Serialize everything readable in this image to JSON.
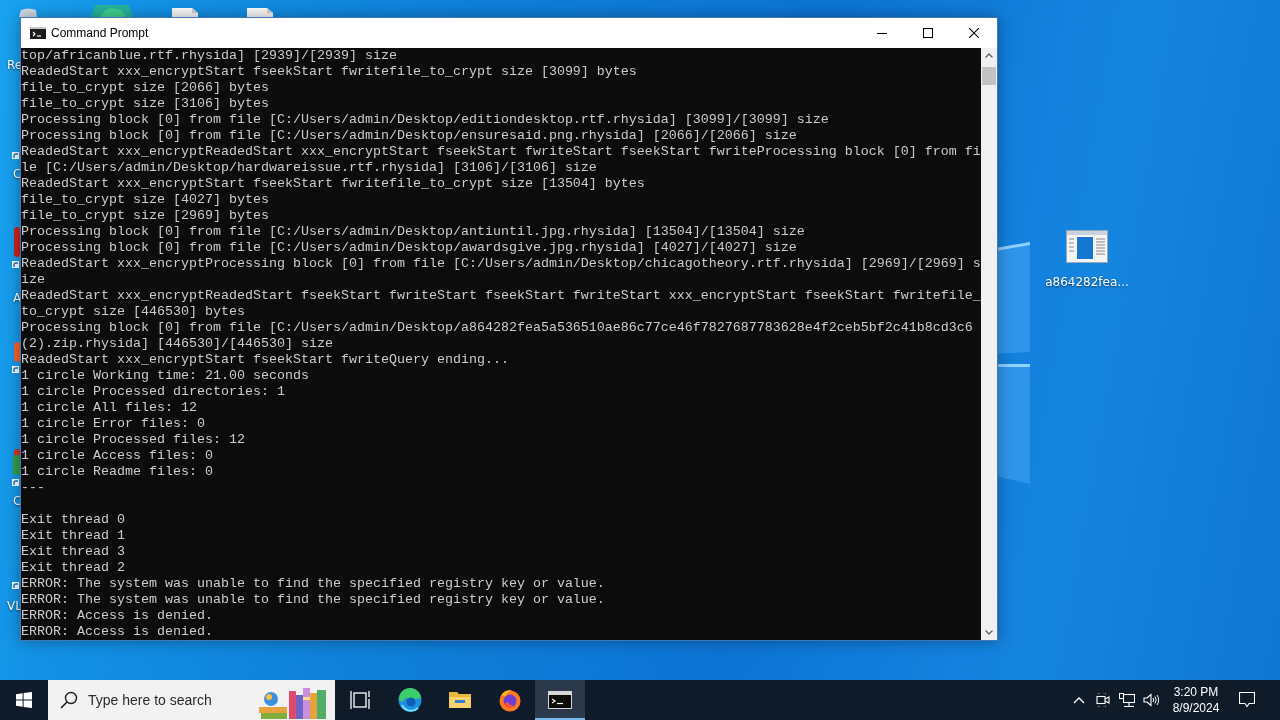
{
  "desktop": {
    "icons": [
      {
        "kind": "recycle-bin",
        "label": "Re"
      },
      {
        "kind": "shortcut",
        "label": "C"
      },
      {
        "kind": "shortcut-red",
        "label": "A"
      },
      {
        "kind": "shortcut-orange"
      },
      {
        "kind": "shortcut-green",
        "label": "C"
      },
      {
        "kind": "shortcut",
        "label": "VL"
      },
      {
        "kind": "round-app"
      },
      {
        "kind": "document"
      },
      {
        "kind": "document"
      },
      {
        "kind": "window-file",
        "label": "a864282fea..."
      }
    ]
  },
  "window": {
    "title": "Command Prompt",
    "console": {
      "lines": [
        {
          "kind": "text",
          "text": "top/africanblue.rtf.rhysida] [2939]/[2939] size"
        },
        {
          "kind": "text",
          "text": "ReadedStart xxx_encryptStart fseekStart fwritefile_to_crypt size [3099] bytes"
        },
        {
          "kind": "text",
          "text": "file_to_crypt size [2066] bytes"
        },
        {
          "kind": "text",
          "text": "file_to_crypt size [3106] bytes"
        },
        {
          "kind": "text",
          "text": "Processing block [0] from file [C:/Users/admin/Desktop/editiondesktop.rtf.rhysida] [3099]/[3099] size"
        },
        {
          "kind": "text",
          "text": "Processing block [0] from file [C:/Users/admin/Desktop/ensuresaid.png.rhysida] [2066]/[2066] size"
        },
        {
          "kind": "text",
          "text": "ReadedStart xxx_encryptReadedStart xxx_encryptStart fseekStart fwriteStart fseekStart fwriteProcessing block [0] from fi"
        },
        {
          "kind": "text",
          "text": "le [C:/Users/admin/Desktop/hardwareissue.rtf.rhysida] [3106]/[3106] size"
        },
        {
          "kind": "text",
          "text": "ReadedStart xxx_encryptStart fseekStart fwritefile_to_crypt size [13504] bytes"
        },
        {
          "kind": "text",
          "text": "file_to_crypt size [4027] bytes"
        },
        {
          "kind": "text",
          "text": "file_to_crypt size [2969] bytes"
        },
        {
          "kind": "text",
          "text": "Processing block [0] from file [C:/Users/admin/Desktop/antiuntil.jpg.rhysida] [13504]/[13504] size"
        },
        {
          "kind": "text",
          "text": "Processing block [0] from file [C:/Users/admin/Desktop/awardsgive.jpg.rhysida] [4027]/[4027] size"
        },
        {
          "kind": "text",
          "text": "ReadedStart xxx_encryptProcessing block [0] from file [C:/Users/admin/Desktop/chicagotheory.rtf.rhysida] [2969]/[2969] s"
        },
        {
          "kind": "text",
          "text": "ize"
        },
        {
          "kind": "text",
          "text": "ReadedStart xxx_encryptReadedStart fseekStart fwriteStart fseekStart fwriteStart xxx_encryptStart fseekStart fwritefile_"
        },
        {
          "kind": "text",
          "text": "to_crypt size [446530] bytes"
        },
        {
          "kind": "text",
          "text": "Processing block [0] from file [C:/Users/admin/Desktop/a864282fea5a536510ae86c77ce46f7827687783628e4f2ceb5bf2c41b8cd3c6"
        },
        {
          "kind": "text",
          "text": "(2).zip.rhysida] [446530]/[446530] size"
        },
        {
          "kind": "text",
          "text": "ReadedStart xxx_encryptStart fseekStart fwriteQuery ending..."
        },
        {
          "kind": "text",
          "text": "1 circle Working time: 21.00 seconds"
        },
        {
          "kind": "text",
          "text": "1 circle Processed directories: 1"
        },
        {
          "kind": "text",
          "text": "1 circle All files: 12"
        },
        {
          "kind": "text",
          "text": "1 circle Error files: 0"
        },
        {
          "kind": "text",
          "text": "1 circle Processed files: 12"
        },
        {
          "kind": "text",
          "text": "1 circle Access files: 0"
        },
        {
          "kind": "text",
          "text": "1 circle Readme files: 0"
        },
        {
          "kind": "text",
          "text": "---"
        },
        {
          "kind": "blank"
        },
        {
          "kind": "text",
          "text": "Exit thread 0"
        },
        {
          "kind": "text",
          "text": "Exit thread 1"
        },
        {
          "kind": "text",
          "text": "Exit thread 3"
        },
        {
          "kind": "text",
          "text": "Exit thread 2"
        },
        {
          "kind": "text",
          "text": "ERROR: The system was unable to find the specified registry key or value."
        },
        {
          "kind": "text",
          "text": "ERROR: The system was unable to find the specified registry key or value."
        },
        {
          "kind": "text",
          "text": "ERROR: Access is denied."
        },
        {
          "kind": "text",
          "text": "ERROR: Access is denied."
        }
      ]
    }
  },
  "taskbar": {
    "search": {
      "placeholder": "Type here to search"
    },
    "apps": [
      {
        "kind": "task-view",
        "selected": false
      },
      {
        "kind": "browser-swirl",
        "selected": false
      },
      {
        "kind": "folder",
        "selected": false
      },
      {
        "kind": "browser-fox",
        "selected": false
      },
      {
        "kind": "console",
        "selected": true
      }
    ],
    "clock": {
      "time": "3:20 PM",
      "date": "8/9/2024"
    }
  }
}
